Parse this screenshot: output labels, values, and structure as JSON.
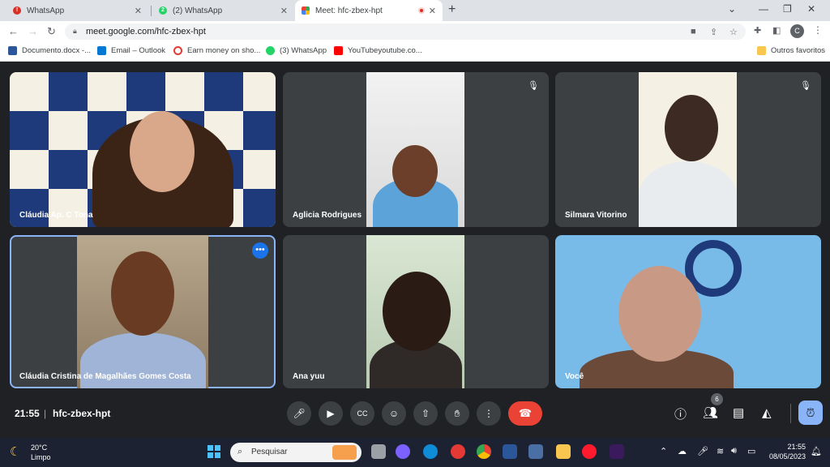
{
  "browser": {
    "tabs": [
      {
        "title": "WhatsApp"
      },
      {
        "title": "(2) WhatsApp",
        "badge": "2"
      },
      {
        "title": "Meet: hfc-zbex-hpt"
      }
    ],
    "new_tab": "+",
    "url": "meet.google.com/hfc-zbex-hpt",
    "profile_initial": "C",
    "bookmarks": [
      {
        "label": "Documento.docx -..."
      },
      {
        "label": "Email – Outlook"
      },
      {
        "label": "Earn money on sho..."
      },
      {
        "label": "(3) WhatsApp"
      },
      {
        "label": "YouTubeyoutube.co..."
      }
    ],
    "other_bookmarks": "Outros favoritos"
  },
  "meet": {
    "participants": [
      {
        "name": "Cláudia Ap. C Tona",
        "muted": false
      },
      {
        "name": "Aglicia Rodrigues",
        "muted": true
      },
      {
        "name": "Silmara Vitorino",
        "muted": true
      },
      {
        "name": "Cláudia Cristina de Magalhães Gomes Costa",
        "muted": false,
        "pinned": true
      },
      {
        "name": "Ana yuu",
        "muted": false
      },
      {
        "name": "Você",
        "muted": false
      }
    ],
    "time": "21:55",
    "separator": "|",
    "meeting_code": "hfc-zbex-hpt",
    "people_count": "6",
    "accent": "#8ab4f8",
    "hangup_color": "#ea4335"
  },
  "taskbar": {
    "temperature": "20°C",
    "weather": "Limpo",
    "search_placeholder": "Pesquisar",
    "time": "21:55",
    "date": "08/05/2023"
  }
}
